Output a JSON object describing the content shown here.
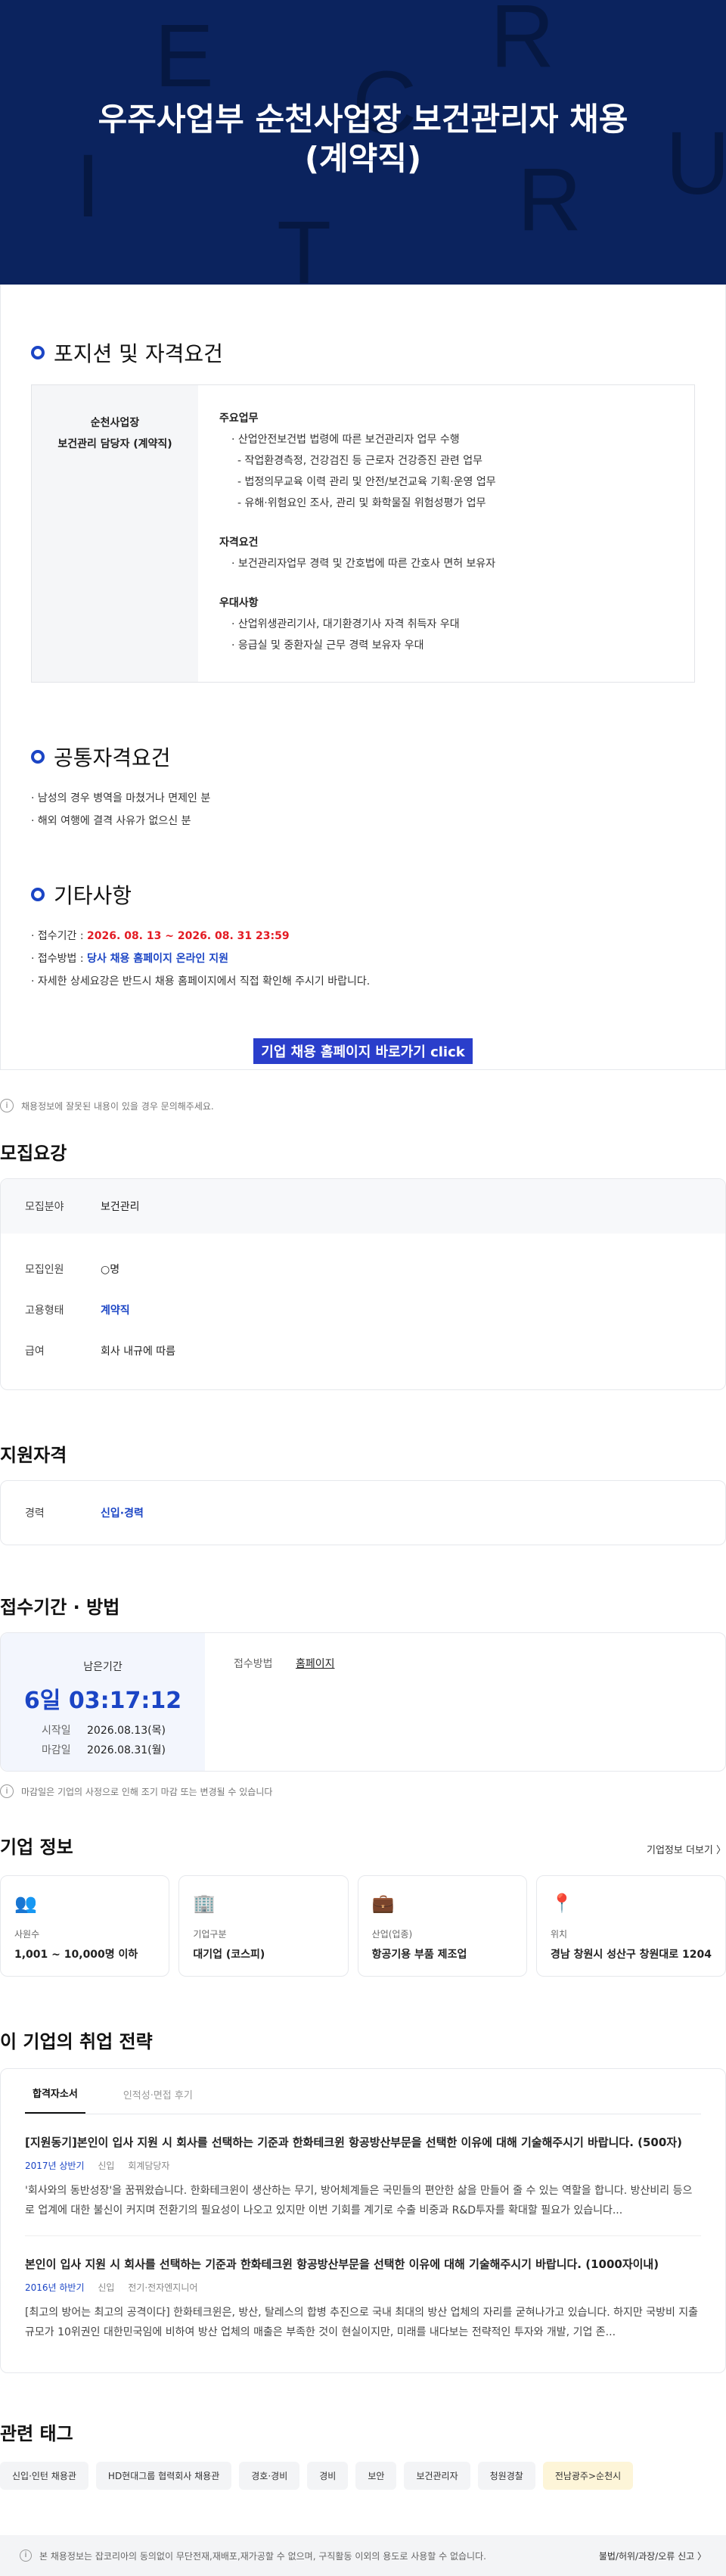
{
  "hero": {
    "title_line1": "우주사업부 순천사업장 보건관리자 채용",
    "title_line2": "(계약직)",
    "deco_letters": [
      "E",
      "R",
      "C",
      "I",
      "U",
      "R",
      "T"
    ]
  },
  "position": {
    "title": "포지션 및 자격요건",
    "role_line1": "순천사업장",
    "role_line2": "보건관리 담당자 (계약직)",
    "duties_title": "주요업무",
    "duties": [
      "· 산업안전보건법 법령에 따른 보건관리자 업무 수행",
      "- 작업환경측정, 건강검진 등 근로자 건강증진 관련 업무",
      "- 법정의무교육 이력 관리 및 안전/보건교육 기획·운영 업무",
      "- 유해·위험요인 조사, 관리 및 화학물질 위험성평가 업무"
    ],
    "qual_title": "자격요건",
    "quals": [
      "· 보건관리자업무 경력 및 간호법에 따른 간호사 면허 보유자"
    ],
    "pref_title": "우대사항",
    "prefs": [
      "· 산업위생관리기사, 대기환경기사 자격 취득자 우대",
      "· 응급실 및 중환자실 근무 경력 보유자 우대"
    ]
  },
  "common": {
    "title": "공통자격요건",
    "items": [
      "· 남성의 경우 병역을 마쳤거나 면제인 분",
      "· 해외 여행에 결격 사유가 없으신 분"
    ]
  },
  "etc": {
    "title": "기타사항",
    "period_label": "· 접수기간 : ",
    "period_value": "2026. 08. 13 ~ 2026. 08. 31 23:59",
    "method_label": "· 접수방법 : ",
    "method_value": "당사 채용 홈페이지 온라인 지원",
    "note": "· 자세한 상세요강은 반드시 채용 홈페이지에서 직접 확인해 주시기 바랍니다.",
    "cta": "기업 채용 홈페이지 바로가기 click"
  },
  "notice": "채용정보에 잘못된 내용이 있을 경우 문의해주세요.",
  "recruit": {
    "title": "모집요강",
    "field_label": "모집분야",
    "field_value": "보건관리",
    "count_label": "모집인원",
    "count_value": "○명",
    "type_label": "고용형태",
    "type_value": "계약직",
    "pay_label": "급여",
    "pay_value": "회사 내규에 따름"
  },
  "qualify": {
    "title": "지원자격",
    "career_label": "경력",
    "career_value": "신입·경력"
  },
  "apply": {
    "title": "접수기간 · 방법",
    "remain_label": "남은기간",
    "remain_value": "6일 03:17:12",
    "start_label": "시작일",
    "start_value": "2026.08.13(목)",
    "end_label": "마감일",
    "end_value": "2026.08.31(월)",
    "method_label": "접수방법",
    "method_value": "홈페이지",
    "notice": "마감일은 기업의 사정으로 인해 조기 마감 또는 변경될 수 있습니다"
  },
  "company": {
    "title": "기업 정보",
    "more": "기업정보 더보기 〉",
    "cards": [
      {
        "icon": "people-icon",
        "label": "사원수",
        "value": "1,001 ~ 10,000명 이하"
      },
      {
        "icon": "building-icon",
        "label": "기업구분",
        "value": "대기업 (코스피)"
      },
      {
        "icon": "briefcase-icon",
        "label": "산업(업종)",
        "value": "항공기용 부품 제조업"
      },
      {
        "icon": "location-pin-icon",
        "label": "위치",
        "value": "경남 창원시 성산구 창원대로 1204"
      }
    ]
  },
  "strategy": {
    "title": "이 기업의 취업 전략",
    "tabs": [
      "합격자소서",
      "인적성·면접 후기"
    ],
    "articles": [
      {
        "title": "[지원동기]본인이 입사 지원 시 회사를 선택하는 기준과 한화테크윈 항공방산부문을 선택한 이유에 대해 기술해주시기 바랍니다. (500자)",
        "year": "2017년 상반기",
        "level": "신입",
        "job": "회계담당자",
        "body": "'회사와의 동반성장'을 꿈꿔왔습니다. 한화테크윈이 생산하는 무기, 방어체계들은 국민들의 편안한 삶을 만들어 줄 수 있는 역할을 합니다. 방산비리 등으로 업계에 대한 불신이 커지며 전환기의 필요성이 나오고 있지만 이번 기회를 계기로 수출 비중과 R&D투자를 확대할 필요가 있습니다..."
      },
      {
        "title": "본인이 입사 지원 시 회사를 선택하는 기준과 한화테크윈 항공방산부문을 선택한 이유에 대해 기술해주시기 바랍니다. (1000자이내)",
        "year": "2016년 하반기",
        "level": "신입",
        "job": "전기·전자엔지니어",
        "body": "[최고의 방어는 최고의 공격이다] 한화테크윈은, 방산, 탈레스의 합병 추진으로 국내 최대의 방산 업체의 자리를 굳혀나가고 있습니다. 하지만 국방비 지출 규모가 10위권인 대한민국임에 비하여 방산 업체의 매출은 부족한 것이 현실이지만, 미래를 내다보는 전략적인 투자와 개발, 기업 존..."
      }
    ]
  },
  "tags": {
    "title": "관련 태그",
    "items": [
      "신입·인턴 채용관",
      "HD현대그룹 협력회사 채용관",
      "경호·경비",
      "경비",
      "보안",
      "보건관리자",
      "청원경찰",
      "전남광주>순천시"
    ]
  },
  "footer": {
    "left": "본 채용정보는 잡코리아의 동의없이 무단전재,재배포,재가공할 수 없으며, 구직활동 이외의 용도로 사용할 수 없습니다.",
    "right": "불법/허위/과장/오류 신고 〉"
  },
  "colors": {
    "hero_bg": "#0b235e",
    "accent": "#1b45c5",
    "deadline_red": "#e31b23",
    "cta_bg": "#2a3ecb"
  }
}
